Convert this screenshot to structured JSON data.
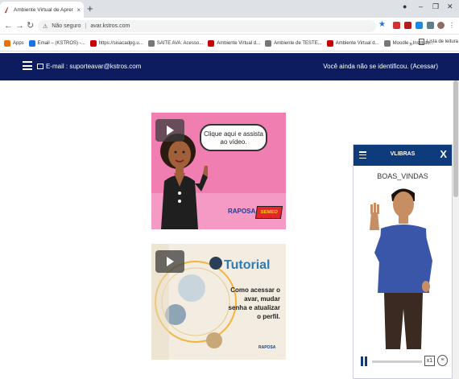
{
  "browser": {
    "tab_title": "Ambiente Virtual de Aprendizag",
    "security_label": "Não seguro",
    "url": "avar.kstros.com",
    "bookmarks": [
      {
        "label": "Apps",
        "color": "#e8710a"
      },
      {
        "label": "Email – (KSTROS) -...",
        "color": "#1a73e8"
      },
      {
        "label": "https://sisacadpg.u...",
        "color": "#c00"
      },
      {
        "label": "SAITE AVA: Acesso...",
        "color": "#777"
      },
      {
        "label": "Ambiente Virtual d...",
        "color": "#c00"
      },
      {
        "label": "Ambiente de TESTE...",
        "color": "#777"
      },
      {
        "label": "Ambiente Virtual d...",
        "color": "#c00"
      },
      {
        "label": "Moodle - Instituto...",
        "color": "#777"
      }
    ],
    "reading_list": "Lista de leitura",
    "more": "»"
  },
  "site": {
    "email_label": "E-mail : suporteavar@kstros.com",
    "login_text": "Você ainda não se identificou. (Acessar)",
    "nav_color": "#0d1c5e"
  },
  "video1": {
    "bubble_text": "Clique aqui e assista ao vídeo.",
    "logo_text": "RAPOSA",
    "badge_text": "SEMED"
  },
  "video2": {
    "title": "Tutorial",
    "text": "Como acessar o avar, mudar senha e atualizar o perfil.",
    "foot_logo": "RAPOSA"
  },
  "vlibras": {
    "title": "VLIBRAS",
    "close": "X",
    "word": "BOAS_VINDAS",
    "speed": "x1"
  }
}
